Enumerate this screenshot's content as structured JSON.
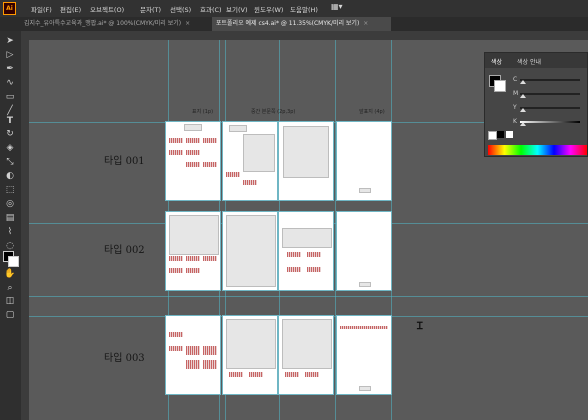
{
  "app": {
    "logo": "Ai"
  },
  "menu": [
    "파일(F)",
    "편집(E)",
    "오브젝트(O)",
    "문자(T)",
    "선택(S)",
    "효과(C)",
    "보기(V)",
    "윈도우(W)",
    "도움말(H)"
  ],
  "tabs": [
    {
      "label": "김지수_유아특수교육과_맹팝.ai* @ 100%(CMYK/미리 보기)",
      "active": false
    },
    {
      "label": "포트폴리오 예제 cs4.ai* @ 11.35%(CMYK/미리 보기)",
      "active": true
    }
  ],
  "columns": [
    "표지 (1p)",
    "중간 본문쪽 (2p,3p)",
    "앞표지 (4p)"
  ],
  "rows": [
    "타입 001",
    "타입 002",
    "타입 003"
  ],
  "color_panel": {
    "tabs": [
      "색상",
      "색상 안내"
    ],
    "sliders": [
      {
        "label": "C",
        "value": 0
      },
      {
        "label": "M",
        "value": 0
      },
      {
        "label": "Y",
        "value": 0
      },
      {
        "label": "K",
        "value": 0
      }
    ]
  },
  "tools": [
    "selection-icon",
    "direct-selection-icon",
    "pen-icon",
    "curvature-icon",
    "rectangle-icon",
    "paintbrush-icon",
    "pencil-icon",
    "type-icon",
    "rotate-icon",
    "eraser-icon",
    "scale-icon",
    "warp-icon",
    "free-transform-icon",
    "shape-builder-icon",
    "gradient-icon",
    "eyedropper-icon",
    "blend-icon",
    "symbol-sprayer-icon",
    "column-graph-icon",
    "artboard-icon",
    "slice-icon",
    "hand-icon",
    "zoom-icon"
  ]
}
